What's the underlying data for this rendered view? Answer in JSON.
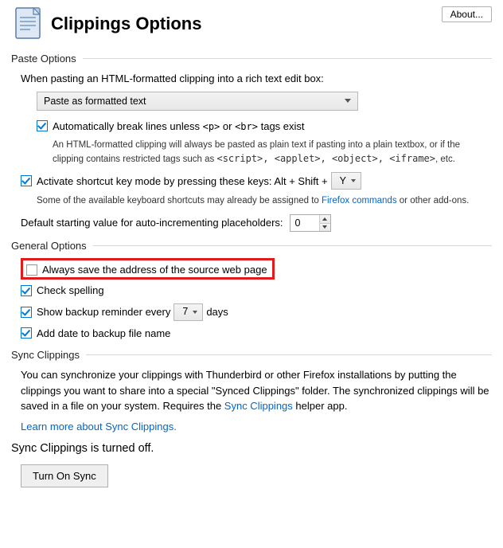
{
  "header": {
    "title": "Clippings Options",
    "about_label": "About..."
  },
  "paste": {
    "section_title": "Paste Options",
    "intro": "When pasting an HTML-formatted clipping into a rich text edit box:",
    "select_value": "Paste as formatted text",
    "auto_break_label_pre": "Automatically break lines unless ",
    "auto_break_tag1": "<p>",
    "auto_break_mid": " or ",
    "auto_break_tag2": "<br>",
    "auto_break_label_post": " tags exist",
    "auto_break_hint_pre": "An HTML-formatted clipping will always be pasted as plain text if pasting into a plain textbox, or if the clipping contains restricted tags such as ",
    "auto_break_hint_tags": "<script>, <applet>, <object>, <iframe>",
    "auto_break_hint_post": ", etc.",
    "shortcut_label_pre": "Activate shortcut key mode by pressing these keys:  Alt + Shift + ",
    "shortcut_key": "Y",
    "shortcut_hint_pre": "Some of the available keyboard shortcuts may already be assigned to ",
    "shortcut_hint_link": "Firefox commands",
    "shortcut_hint_post": " or other add-ons.",
    "autoincr_label": "Default starting value for auto-incrementing placeholders:",
    "autoincr_value": "0"
  },
  "general": {
    "section_title": "General Options",
    "always_save_label": "Always save the address of the source web page",
    "check_spelling_label": "Check spelling",
    "backup_pre": "Show backup reminder every",
    "backup_days": "7",
    "backup_post": "days",
    "add_date_label": "Add date to backup file name"
  },
  "sync": {
    "section_title": "Sync Clippings",
    "desc_pre": "You can synchronize your clippings with Thunderbird or other Firefox installations by putting the clippings you want to share into a special \"Synced Clippings\" folder. The synchronized clippings will be saved in a file on your system. Requires the ",
    "desc_link": "Sync Clippings",
    "desc_post": " helper app.",
    "learn_link": "Learn more about Sync Clippings.",
    "status": "Sync Clippings is turned off.",
    "button_label": "Turn On Sync"
  }
}
